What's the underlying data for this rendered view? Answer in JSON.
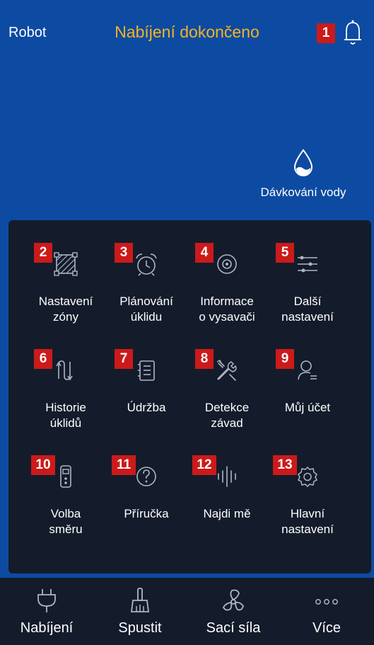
{
  "header": {
    "robot_label": "Robot",
    "status": "Nabíjení dokončeno",
    "bell_badge": "1"
  },
  "water": {
    "label": "Dávkování vody"
  },
  "menu": [
    {
      "badge": "2",
      "label": "Nastavení\nzóny",
      "icon": "zone-icon"
    },
    {
      "badge": "3",
      "label": "Plánování\núklidu",
      "icon": "alarm-clock-icon"
    },
    {
      "badge": "4",
      "label": "Informace\no vysavači",
      "icon": "robot-vacuum-icon"
    },
    {
      "badge": "5",
      "label": "Další\nnastavení",
      "icon": "sliders-icon"
    },
    {
      "badge": "6",
      "label": "Historie\núklidů",
      "icon": "path-history-icon"
    },
    {
      "badge": "7",
      "label": "Údržba",
      "icon": "list-document-icon"
    },
    {
      "badge": "8",
      "label": "Detekce\nzávad",
      "icon": "tools-icon"
    },
    {
      "badge": "9",
      "label": "Můj účet",
      "icon": "user-icon"
    },
    {
      "badge": "10",
      "label": "Volba\nsměru",
      "icon": "remote-control-icon"
    },
    {
      "badge": "11",
      "label": "Příručka",
      "icon": "help-icon"
    },
    {
      "badge": "12",
      "label": "Najdi mě",
      "icon": "sound-wave-icon"
    },
    {
      "badge": "13",
      "label": "Hlavní\nnastavení",
      "icon": "settings-icon"
    }
  ],
  "bottom_nav": [
    {
      "label": "Nabíjení",
      "icon": "plug-icon"
    },
    {
      "label": "Spustit",
      "icon": "broom-icon"
    },
    {
      "label": "Sací síla",
      "icon": "fan-icon"
    },
    {
      "label": "Více",
      "icon": "more-icon"
    }
  ],
  "colors": {
    "background": "#0d4ba2",
    "panel": "#141c2b",
    "status": "#f5b324",
    "badge": "#cc1a1a"
  }
}
